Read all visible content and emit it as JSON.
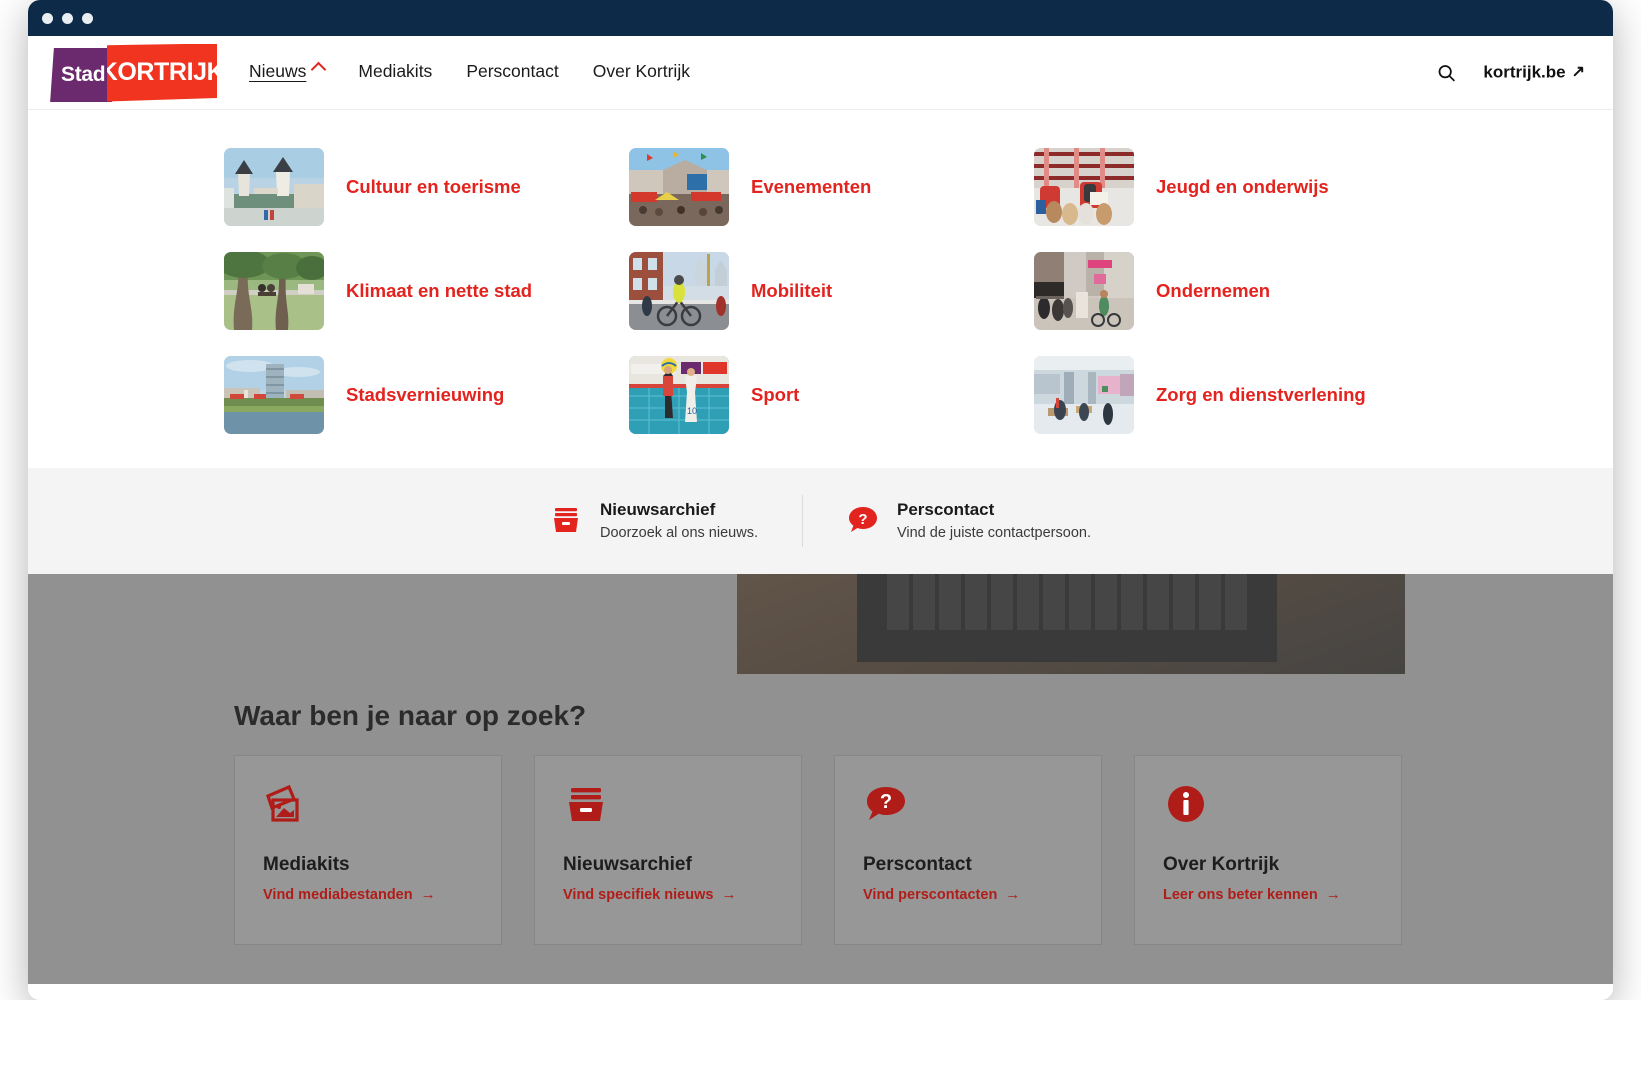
{
  "window": {
    "traffic_lights": [
      "close",
      "minimize",
      "maximize"
    ]
  },
  "header": {
    "logo": {
      "word1": "Stad",
      "word2": "KORTRIJK"
    },
    "nav": [
      {
        "label": "Nieuws",
        "active": true,
        "has_chevron": true,
        "chevron": "chevron-up-icon"
      },
      {
        "label": "Mediakits",
        "active": false,
        "has_chevron": false
      },
      {
        "label": "Perscontact",
        "active": false,
        "has_chevron": false
      },
      {
        "label": "Over Kortrijk",
        "active": false,
        "has_chevron": false
      }
    ],
    "search_icon": "search-icon",
    "site_link": {
      "label": "kortrijk.be",
      "icon": "external-link-arrow-icon",
      "glyph": "↗"
    }
  },
  "mega_menu": {
    "items": [
      {
        "label": "Cultuur en toerisme",
        "image": "broel-towers-photo"
      },
      {
        "label": "Evenementen",
        "image": "festival-square-photo"
      },
      {
        "label": "Jeugd en onderwijs",
        "image": "library-children-photo"
      },
      {
        "label": "Klimaat en nette stad",
        "image": "park-trees-photo"
      },
      {
        "label": "Mobiliteit",
        "image": "cyclists-street-photo"
      },
      {
        "label": "Ondernemen",
        "image": "shopping-street-terrace-photo"
      },
      {
        "label": "Stadsvernieuwing",
        "image": "k-tower-waterfront-photo"
      },
      {
        "label": "Sport",
        "image": "volleyball-match-photo"
      },
      {
        "label": "Zorg en dienstverlening",
        "image": "service-hall-photo"
      }
    ]
  },
  "utility_bar": {
    "items": [
      {
        "icon": "archive-box-icon",
        "title": "Nieuwsarchief",
        "subtitle": "Doorzoek al ons nieuws."
      },
      {
        "icon": "question-speech-bubble-icon",
        "title": "Perscontact",
        "subtitle": "Vind de juiste contactpersoon."
      }
    ]
  },
  "page_below": {
    "heading": "Waar ben je naar op zoek?",
    "cards": [
      {
        "icon": "photos-stack-icon",
        "title": "Mediakits",
        "link": "Vind mediabestanden",
        "arrow": "→"
      },
      {
        "icon": "archive-box-icon",
        "title": "Nieuwsarchief",
        "link": "Vind specifiek nieuws",
        "arrow": "→"
      },
      {
        "icon": "question-speech-bubble-icon",
        "title": "Perscontact",
        "link": "Vind perscontacten",
        "arrow": "→"
      },
      {
        "icon": "info-circle-icon",
        "title": "Over Kortrijk",
        "link": "Leer ons beter kennen",
        "arrow": "→"
      }
    ]
  },
  "colors": {
    "brand_red": "#e3231e",
    "brand_purple": "#6b2a6e",
    "logo_red": "#f0341f",
    "titlebar": "#0d2b48",
    "utility_bg": "#f4f4f4",
    "dim_overlay": "rgba(77,77,77,0.62)",
    "card_link_red": "#b01d18"
  }
}
